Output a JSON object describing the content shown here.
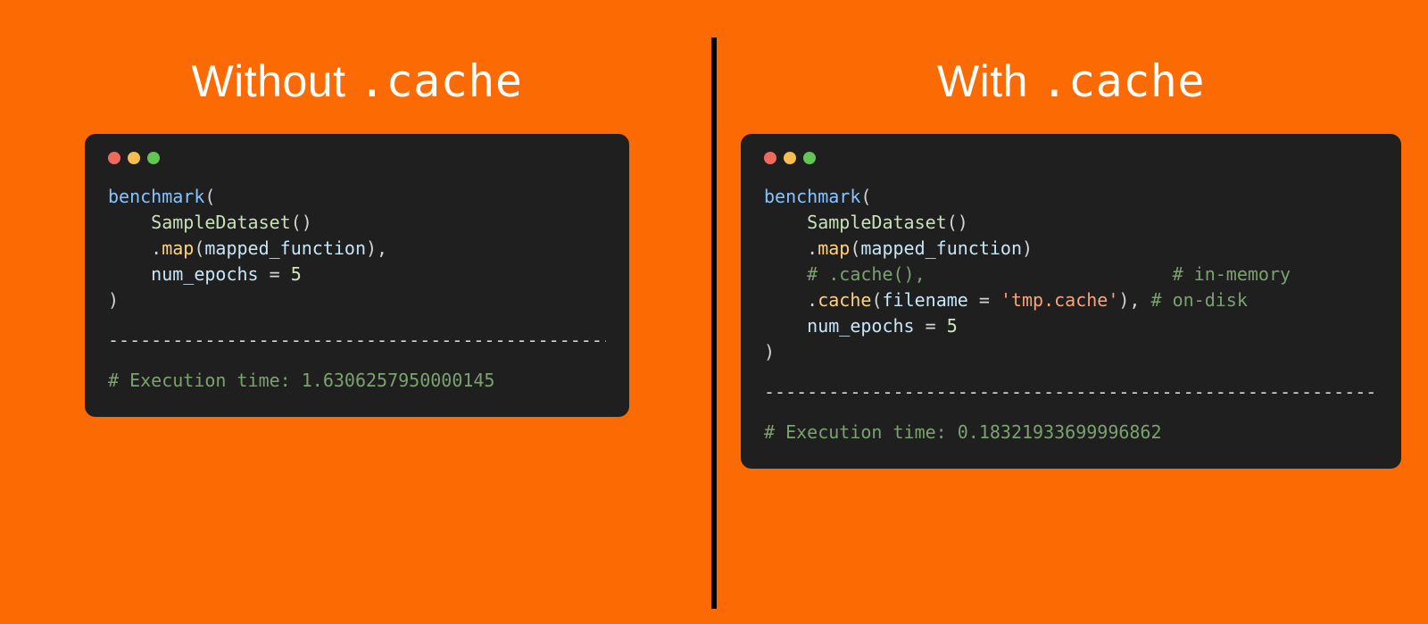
{
  "left": {
    "title_plain": "Without ",
    "title_mono": ".cache",
    "code": {
      "l1_fn": "benchmark",
      "l1_open": "(",
      "l2_indent": "    ",
      "l2_type": "SampleDataset",
      "l2_call": "()",
      "l3_indent": "    ",
      "l3_dot": ".",
      "l3_method": "map",
      "l3_open": "(",
      "l3_arg": "mapped_function",
      "l3_close": "),",
      "l4_indent": "    ",
      "l4_kw": "num_epochs",
      "l4_eq": " = ",
      "l4_val": "5",
      "l5_close": ")",
      "divider": "------------------------------------------------",
      "exec_comment": "# Execution time: 1.6306257950000145"
    }
  },
  "right": {
    "title_plain": "With ",
    "title_mono": ".cache",
    "code": {
      "l1_fn": "benchmark",
      "l1_open": "(",
      "l2_indent": "    ",
      "l2_type": "SampleDataset",
      "l2_call": "()",
      "l3_indent": "    ",
      "l3_dot": ".",
      "l3_method": "map",
      "l3_open": "(",
      "l3_arg": "mapped_function",
      "l3_close": ")",
      "l4_indent": "    ",
      "l4_c1": "# .cache(),",
      "l4_pad": "                       ",
      "l4_c2": "# in-memory",
      "l5_indent": "    ",
      "l5_dot": ".",
      "l5_method": "cache",
      "l5_open": "(",
      "l5_kw": "filename",
      "l5_eq": " = ",
      "l5_str": "'tmp.cache'",
      "l5_close": "), ",
      "l5_c": "# on-disk",
      "l6_indent": "    ",
      "l6_kw": "num_epochs",
      "l6_eq": " = ",
      "l6_val": "5",
      "l7_close": ")",
      "divider": "-------------------------------------------------------------",
      "exec_comment": "# Execution time: 0.18321933699996862"
    }
  }
}
